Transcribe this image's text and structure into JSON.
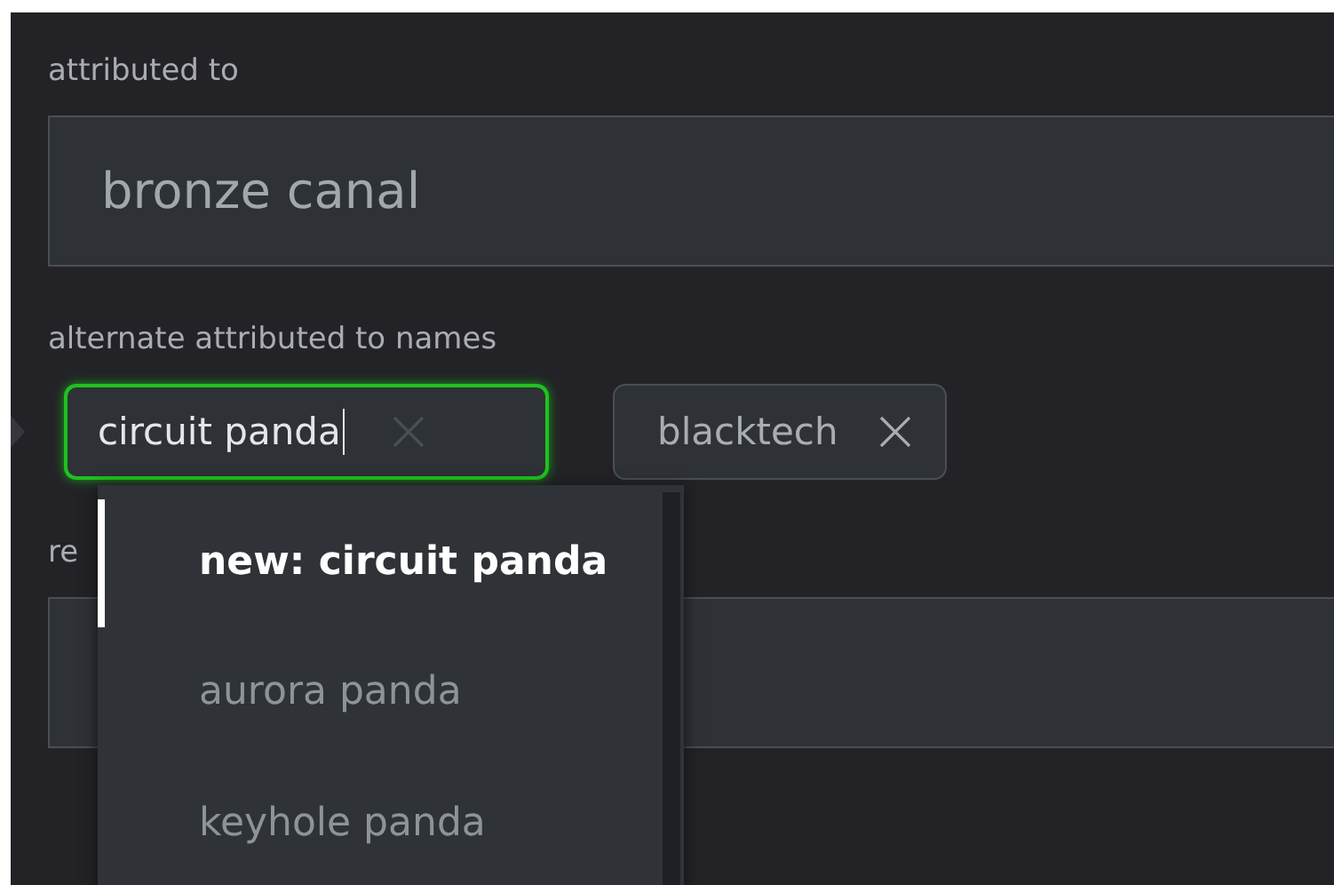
{
  "fields": [
    {
      "kind": "text",
      "label": "attributed to",
      "value": "bronze canal"
    },
    {
      "kind": "tags",
      "label": "alternate attributed to names",
      "input": {
        "value": "circuit panda"
      },
      "tags": [
        {
          "label": "blacktech"
        }
      ]
    },
    {
      "kind": "text",
      "label": "re"
    }
  ],
  "suggestions": [
    {
      "label": "new: circuit panda",
      "selected": true
    },
    {
      "label": "aurora panda",
      "selected": false
    },
    {
      "label": "keyhole panda",
      "selected": false
    }
  ]
}
